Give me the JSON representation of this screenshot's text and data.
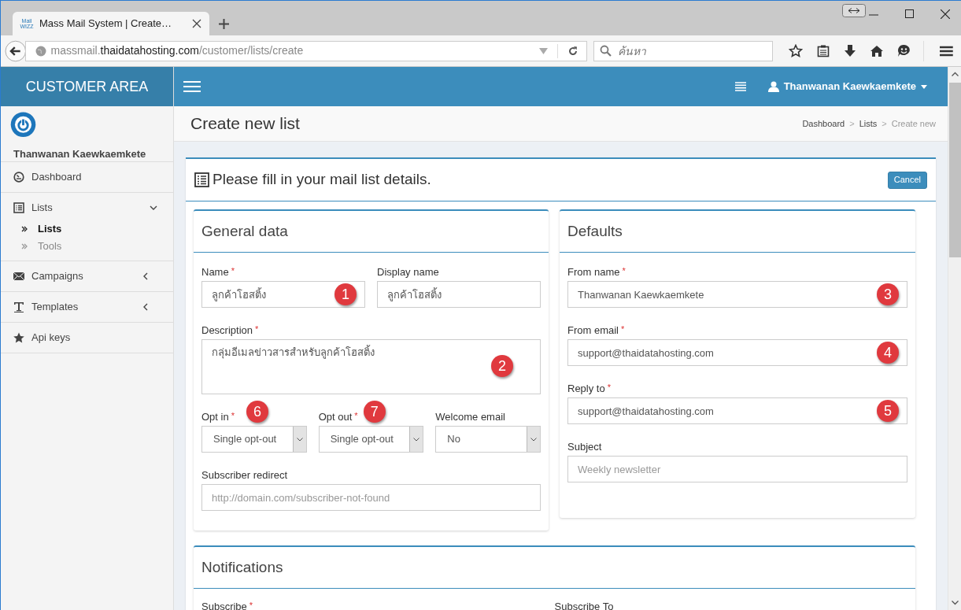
{
  "browser": {
    "tab": {
      "favicon_lines": [
        "Mail",
        "WIZZ"
      ],
      "title": "Mass Mail System | Create…"
    },
    "address": {
      "prefix": "massmail.",
      "domain": "thaidatahosting.com",
      "path": "/customer/lists/create"
    },
    "search": {
      "placeholder": "ค้นหา"
    }
  },
  "header": {
    "brand": "CUSTOMER AREA",
    "user": "Thanwanan Kaewkaemkete"
  },
  "sidebar": {
    "user": "Thanwanan Kaewkaemkete",
    "items": [
      {
        "label": "Dashboard"
      },
      {
        "label": "Lists",
        "expanded": true,
        "children": [
          {
            "label": "Lists",
            "selected": true
          },
          {
            "label": "Tools",
            "selected": false
          }
        ]
      },
      {
        "label": "Campaigns",
        "expanded": false
      },
      {
        "label": "Templates",
        "expanded": false
      },
      {
        "label": "Api keys"
      }
    ]
  },
  "page": {
    "title": "Create new list",
    "breadcrumbs": [
      {
        "label": "Dashboard",
        "current": false,
        "separator": ">"
      },
      {
        "label": "Lists",
        "current": false,
        "separator": ">"
      },
      {
        "label": "Create new",
        "current": true
      }
    ]
  },
  "form": {
    "heading": "Please fill in your mail list details.",
    "cancel": "Cancel",
    "general": {
      "title": "General data",
      "rows": [
        {
          "fields": [
            {
              "kind": "text",
              "label": "Name",
              "required_mark": "*",
              "value": "ลูกค้าโฮสติ้ง",
              "marker": "1"
            },
            {
              "kind": "text",
              "label": "Display name",
              "value": "ลูกค้าโฮสติ้ง"
            }
          ]
        },
        {
          "fields": [
            {
              "kind": "textarea",
              "label": "Description",
              "required_mark": "*",
              "value": "กลุ่มอีเมลข่าวสารสำหรับลูกค้าโฮสติ้ง",
              "marker": "2"
            }
          ]
        },
        {
          "fields": [
            {
              "kind": "select",
              "label": "Opt in",
              "required_mark": "*",
              "value": "Single opt-out",
              "marker": "6"
            },
            {
              "kind": "select",
              "label": "Opt out",
              "required_mark": "*",
              "value": "Single opt-out",
              "marker": "7"
            },
            {
              "kind": "select",
              "label": "Welcome email",
              "value": "No"
            }
          ]
        },
        {
          "fields": [
            {
              "kind": "text",
              "label": "Subscriber redirect",
              "placeholder": "http://domain.com/subscriber-not-found"
            }
          ]
        }
      ]
    },
    "defaults": {
      "title": "Defaults",
      "fields": [
        {
          "kind": "text",
          "label": "From name",
          "required_mark": "*",
          "value": "Thanwanan Kaewkaemkete",
          "marker": "3"
        },
        {
          "kind": "text",
          "label": "From email",
          "required_mark": "*",
          "value": "support@thaidatahosting.com",
          "marker": "4"
        },
        {
          "kind": "text",
          "label": "Reply to",
          "required_mark": "*",
          "value": "support@thaidatahosting.com",
          "marker": "5"
        },
        {
          "kind": "text",
          "label": "Subject",
          "placeholder": "Weekly newsletter"
        }
      ]
    },
    "notifications": {
      "title": "Notifications",
      "fields": [
        {
          "label": "Subscribe",
          "required_mark": "*"
        },
        {
          "label": "Subscribe To"
        }
      ]
    }
  }
}
